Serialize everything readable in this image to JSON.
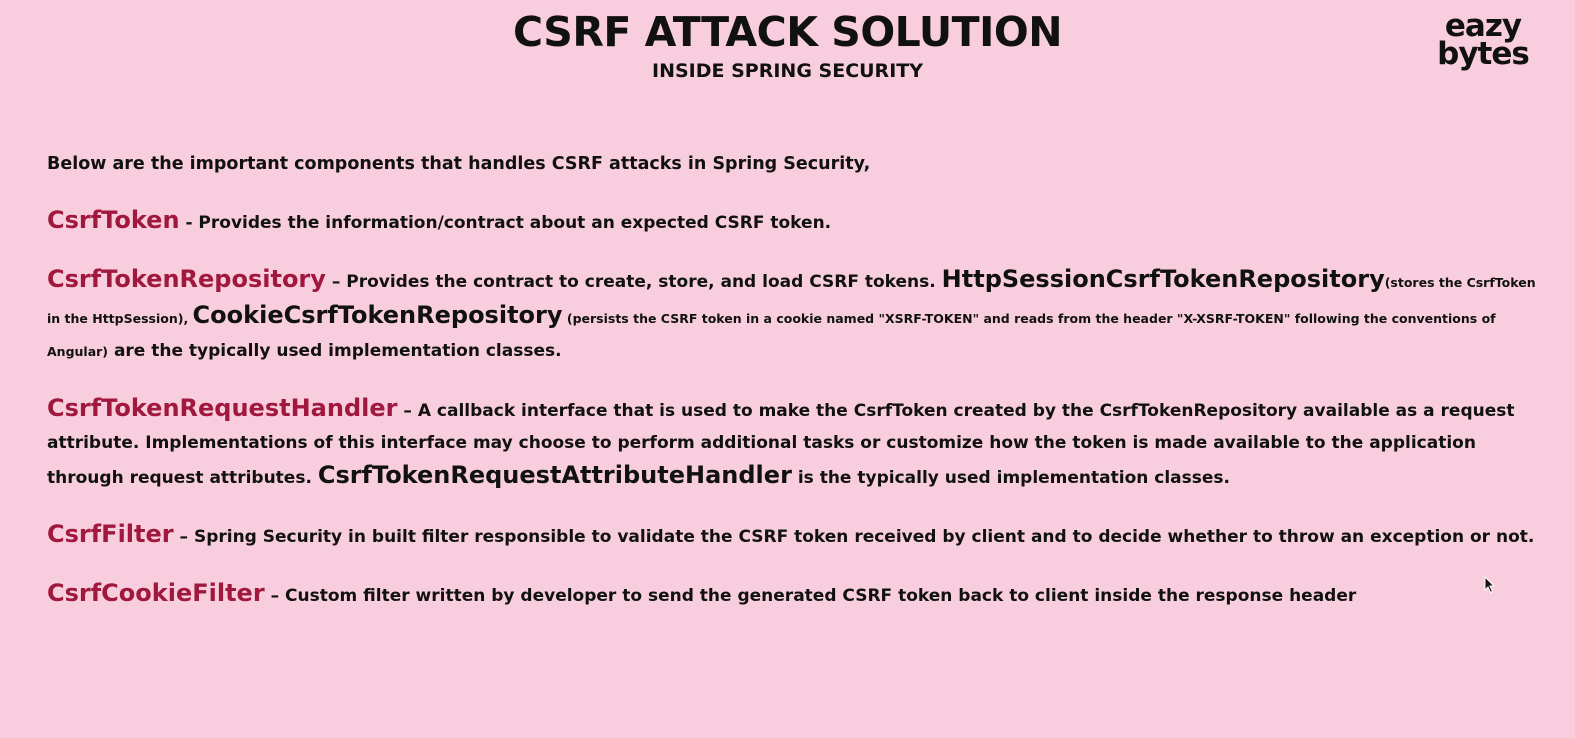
{
  "header": {
    "title": "CSRF ATTACK SOLUTION",
    "subtitle": "INSIDE SPRING SECURITY"
  },
  "logo": {
    "line1": "eazy",
    "line2": "bytes"
  },
  "intro": "Below are the important components that handles CSRF attacks in Spring Security,",
  "items": {
    "token": {
      "term": "CsrfToken",
      "desc": " - Provides the information/contract about an expected CSRF token."
    },
    "repository": {
      "term": "CsrfTokenRepository",
      "desc1": " – Provides the contract to create, store, and load CSRF tokens. ",
      "impl1": "HttpSessionCsrfTokenRepository",
      "note1": "(stores the CsrfToken in the HttpSession), ",
      "impl2": "CookieCsrfTokenRepository",
      "note2": " (persists the CSRF token in a cookie named \"XSRF-TOKEN\" and reads from the header \"X-XSRF-TOKEN\" following the conventions of Angular)",
      "desc2": " are the typically used implementation classes."
    },
    "handler": {
      "term": "CsrfTokenRequestHandler",
      "desc1": " –   A callback interface that is used to make the CsrfToken created by the CsrfTokenRepository available as a request attribute. Implementations of this interface may choose to perform additional tasks or customize how the token is made available to the application through request attributes. ",
      "impl": "CsrfTokenRequestAttributeHandler",
      "desc2": " is the typically used implementation classes."
    },
    "filter": {
      "term": "CsrfFilter",
      "desc": " – Spring Security in built filter responsible to validate the CSRF token received by client and to decide whether to throw an exception or not."
    },
    "cookie_filter": {
      "term": "CsrfCookieFilter",
      "desc": " – Custom filter written by developer to send the generated CSRF token back to client inside the response header"
    }
  },
  "colors": {
    "background": "#f8cede",
    "accent": "#a1183e",
    "text": "#111111"
  },
  "icons": {
    "cursor": "mouse-pointer-icon"
  }
}
